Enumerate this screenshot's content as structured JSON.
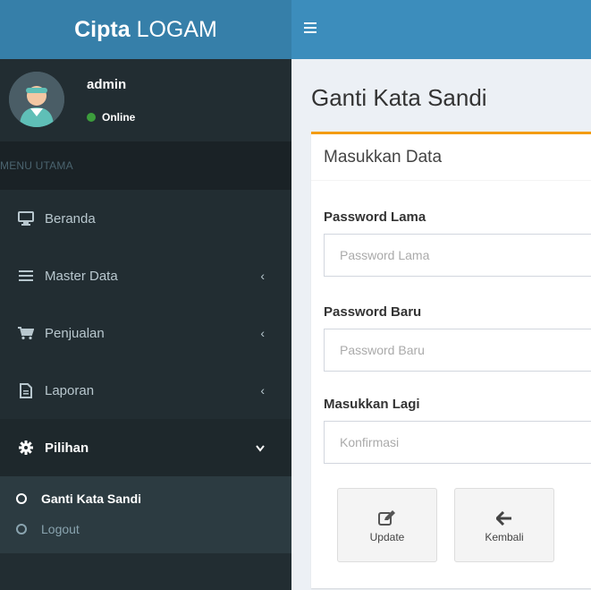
{
  "header": {
    "logo_bold": "Cipta",
    "logo_rest": "LOGAM"
  },
  "user": {
    "name": "admin",
    "status": "Online"
  },
  "sidebar": {
    "menu_header": "MENU UTAMA",
    "items": [
      {
        "label": "Beranda",
        "icon": "desktop-icon"
      },
      {
        "label": "Master Data",
        "icon": "list-icon"
      },
      {
        "label": "Penjualan",
        "icon": "cart-icon"
      },
      {
        "label": "Laporan",
        "icon": "file-icon"
      },
      {
        "label": "Pilihan",
        "icon": "gear-icon"
      }
    ],
    "submenu": [
      {
        "label": "Ganti Kata Sandi",
        "active": true
      },
      {
        "label": "Logout",
        "active": false
      }
    ]
  },
  "page": {
    "title": "Ganti Kata Sandi"
  },
  "form": {
    "box_title": "Masukkan Data",
    "old_password": {
      "label": "Password Lama",
      "placeholder": "Password Lama"
    },
    "new_password": {
      "label": "Password Baru",
      "placeholder": "Password Baru"
    },
    "confirm_password": {
      "label": "Masukkan Lagi",
      "placeholder": "Konfirmasi"
    },
    "update_label": "Update",
    "back_label": "Kembali"
  },
  "colors": {
    "header_logo": "#367fa9",
    "header_bar": "#3c8dbc",
    "sidebar_bg": "#222d32",
    "box_accent": "#f39c12",
    "online": "#3c9d3c"
  }
}
